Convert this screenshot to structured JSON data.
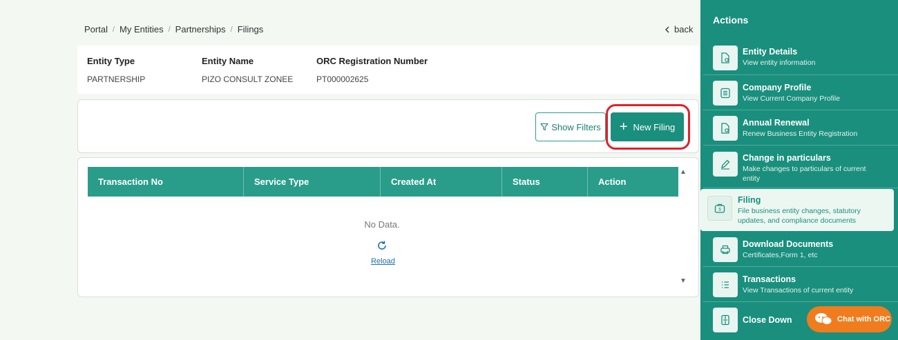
{
  "breadcrumb": {
    "items": [
      "Portal",
      "My Entities",
      "Partnerships",
      "Filings"
    ],
    "separator": "/"
  },
  "back_label": "back",
  "entity": {
    "type_label": "Entity Type",
    "type_value": "PARTNERSHIP",
    "name_label": "Entity Name",
    "name_value": "PIZO CONSULT ZONEE",
    "reg_label": "ORC Registration Number",
    "reg_value": "PT000002625"
  },
  "toolbar": {
    "show_filters_label": "Show Filters",
    "new_filing_label": "New Filing",
    "filter_icon": "filter-icon",
    "plus_icon": "plus-icon"
  },
  "table": {
    "columns": [
      "Transaction No",
      "Service Type",
      "Created At",
      "Status",
      "Action"
    ],
    "empty_text": "No Data.",
    "reload_label": "Reload"
  },
  "sidebar": {
    "title": "Actions",
    "items": [
      {
        "title": "Entity Details",
        "desc": "View entity information",
        "icon": "document-eye-icon"
      },
      {
        "title": "Company Profile",
        "desc": "View Current Company Profile",
        "icon": "list-icon"
      },
      {
        "title": "Annual Renewal",
        "desc": "Renew Business Entity Registration",
        "icon": "document-eye-icon"
      },
      {
        "title": "Change in particulars",
        "desc": "Make changes to particulars of current entity",
        "icon": "pencil-icon"
      },
      {
        "title": "Filing",
        "desc": "File business entity changes, statutory updates, and compliance documents",
        "icon": "briefcase-icon",
        "active": true
      },
      {
        "title": "Download Documents",
        "desc": "Certificates,Form 1, etc",
        "icon": "printer-icon"
      },
      {
        "title": "Transactions",
        "desc": "View Transactions of current entity",
        "icon": "list-bullets-icon"
      },
      {
        "title": "Close Down",
        "desc": "",
        "icon": "door-icon"
      }
    ]
  },
  "chat": {
    "label": "Chat with ORC",
    "icon": "chat-bubbles-icon"
  },
  "colors": {
    "primary": "#1a8f7d",
    "table_header": "#2a9d8a",
    "highlight": "#e0202a",
    "chat": "#f07c1e",
    "background": "#f3f8f3"
  }
}
